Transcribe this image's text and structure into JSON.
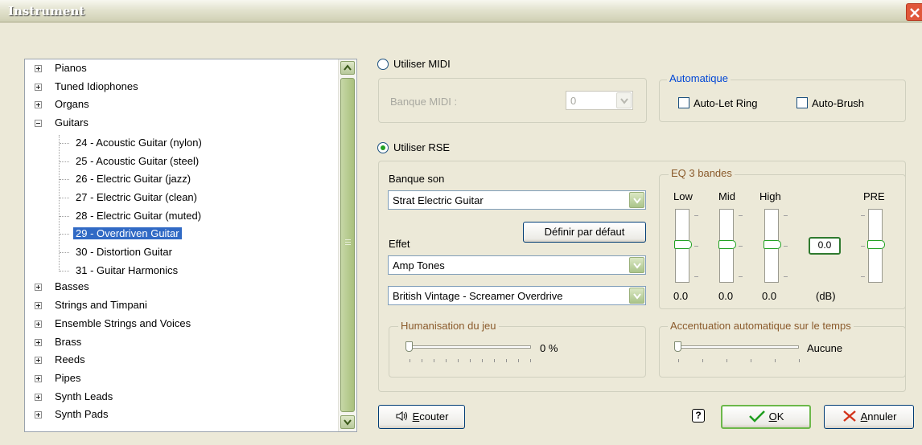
{
  "window": {
    "title": "Instrument"
  },
  "tree": {
    "categories_top": [
      "Pianos",
      "Tuned Idiophones",
      "Organs",
      "Guitars"
    ],
    "guitars": [
      "24 - Acoustic Guitar (nylon)",
      "25 - Acoustic Guitar (steel)",
      "26 - Electric Guitar (jazz)",
      "27 - Electric Guitar (clean)",
      "28 - Electric Guitar (muted)",
      "29 - Overdriven Guitar",
      "30 - Distortion Guitar",
      "31 - Guitar Harmonics"
    ],
    "selected": "29 - Overdriven Guitar",
    "categories_bottom": [
      "Basses",
      "Strings and Timpani",
      "Ensemble Strings and Voices",
      "Brass",
      "Reeds",
      "Pipes",
      "Synth Leads",
      "Synth Pads"
    ]
  },
  "midi": {
    "radio_label": "Utiliser MIDI",
    "selected": false,
    "bank_label": "Banque MIDI :",
    "bank_value": "0"
  },
  "automatique": {
    "title": "Automatique",
    "auto_let_ring": {
      "label": "Auto-Let Ring",
      "checked": false
    },
    "auto_brush": {
      "label": "Auto-Brush",
      "checked": false
    }
  },
  "rse": {
    "radio_label": "Utiliser RSE",
    "selected": true,
    "sound_bank_label": "Banque son",
    "sound_bank_value": "Strat Electric Guitar",
    "default_button": "Définir par défaut",
    "effect_label": "Effet",
    "effect_value": "Amp Tones",
    "preset_value": "British Vintage - Screamer Overdrive"
  },
  "eq": {
    "title": "EQ 3 bandes",
    "bands": [
      {
        "label": "Low",
        "value": "0.0"
      },
      {
        "label": "Mid",
        "value": "0.0"
      },
      {
        "label": "High",
        "value": "0.0"
      }
    ],
    "pre_label": "PRE",
    "pre_value": "0.0",
    "unit": "(dB)"
  },
  "humanisation": {
    "title": "Humanisation du jeu",
    "value": "0 %"
  },
  "accentuation": {
    "title": "Accentuation automatique sur le temps",
    "value": "Aucune"
  },
  "buttons": {
    "listen_prefix": "E",
    "listen_rest": "couter",
    "help": "?",
    "ok_prefix": "O",
    "ok_rest": "K",
    "cancel_prefix": "A",
    "cancel_rest": "nnuler"
  },
  "colors": {
    "selection": "#316ac5",
    "radio_dot": "#21a121",
    "group_title": "#0046d5"
  }
}
